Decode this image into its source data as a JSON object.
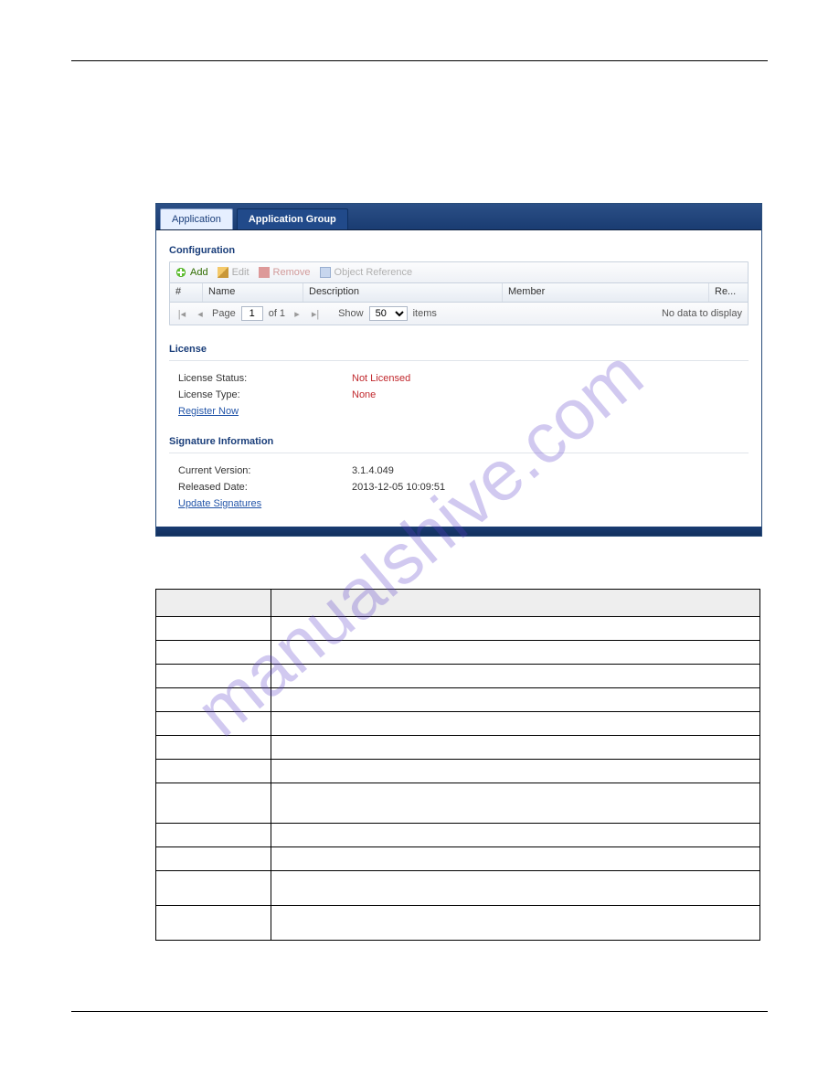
{
  "watermark": "manualshive.com",
  "tabs": {
    "application": "Application",
    "application_group": "Application Group"
  },
  "sections": {
    "configuration": "Configuration",
    "license": "License",
    "signature": "Signature Information"
  },
  "toolbar": {
    "add": "Add",
    "edit": "Edit",
    "remove": "Remove",
    "obj_ref": "Object Reference"
  },
  "grid": {
    "columns": {
      "idx": "#",
      "name": "Name",
      "desc": "Description",
      "member": "Member",
      "re": "Re..."
    }
  },
  "pager": {
    "page_label": "Page",
    "page_value": "1",
    "of_label": "of 1",
    "show_label": "Show",
    "show_value": "50",
    "items_label": "items",
    "empty": "No data to display"
  },
  "license": {
    "status_label": "License Status:",
    "status_value": "Not Licensed",
    "type_label": "License Type:",
    "type_value": "None",
    "register": "Register Now"
  },
  "sig": {
    "version_label": "Current Version:",
    "version_value": "3.1.4.049",
    "released_label": "Released Date:",
    "released_value": "2013-12-05 10:09:51",
    "update": "Update Signatures"
  }
}
